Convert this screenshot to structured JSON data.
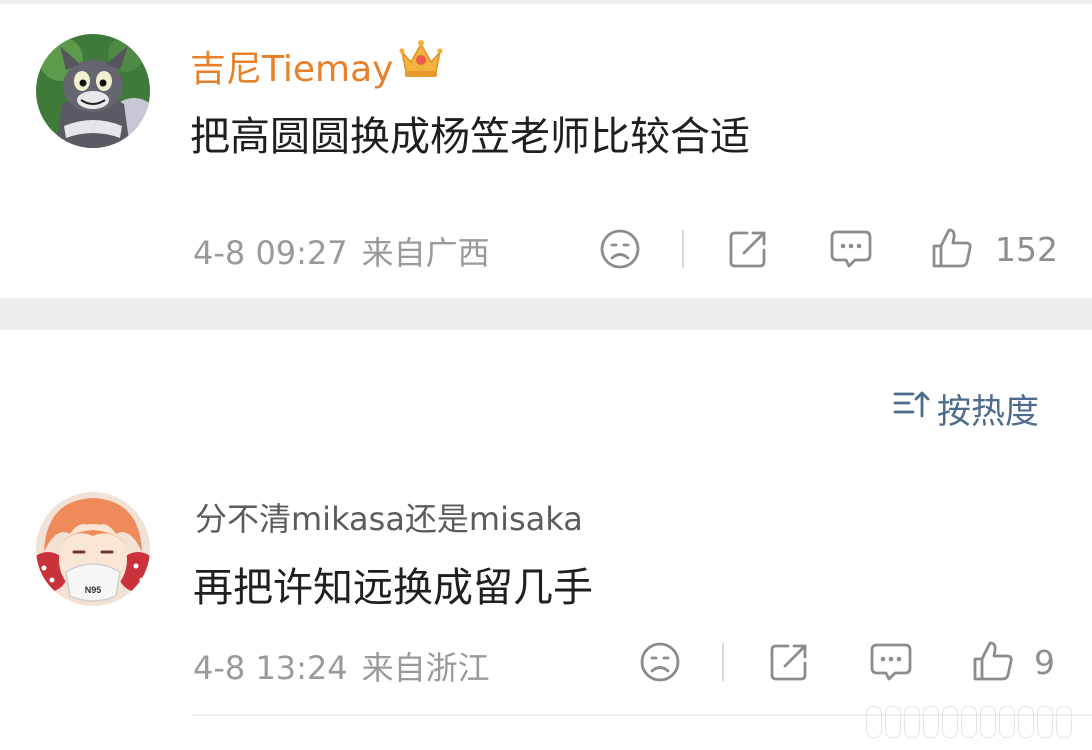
{
  "sort": {
    "label": "按热度"
  },
  "comments": [
    {
      "username": "吉尼Tiemay",
      "text": "把高圆圆换成杨笠老师比较合适",
      "date": "4-8 09:27",
      "location": "来自广西",
      "likes": "152"
    },
    {
      "username": "分不清mikasa还是misaka",
      "text": "再把许知远换成留几手",
      "date": "4-8 13:24",
      "location": "来自浙江",
      "likes": "9",
      "avatar_mask_text": "N95"
    }
  ],
  "icons": [
    "frown-icon",
    "share-icon",
    "comment-icon",
    "thumbs-up-icon",
    "crown-badge-icon",
    "sort-icon"
  ],
  "colors": {
    "vip_name": "#e8812b",
    "sort_link": "#4d6b8c",
    "meta": "#9a9a9a"
  }
}
